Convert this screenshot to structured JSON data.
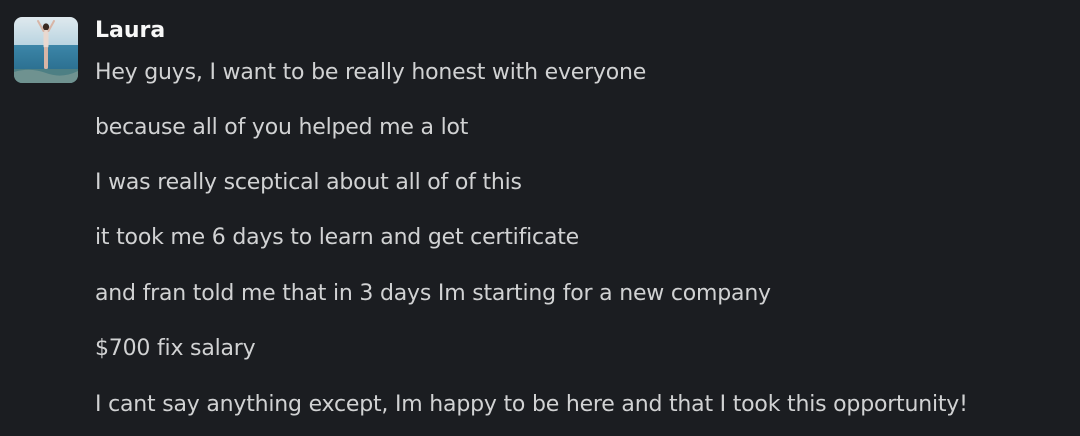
{
  "message": {
    "author": "Laura",
    "avatar_icon": "user-photo-avatar",
    "lines": [
      "Hey guys, I want to be really honest with everyone",
      "because all of you helped me a lot",
      "I was really sceptical about all of of this",
      "it took me 6 days to learn and get certificate",
      "and fran told me that in 3 days Im starting for a new company",
      "$700 fix salary",
      "I cant say anything except, Im happy to be here and that I took this opportunity!"
    ]
  },
  "colors": {
    "background": "#1b1d21",
    "author": "#f8f8f8",
    "text": "#d1d2d3"
  }
}
